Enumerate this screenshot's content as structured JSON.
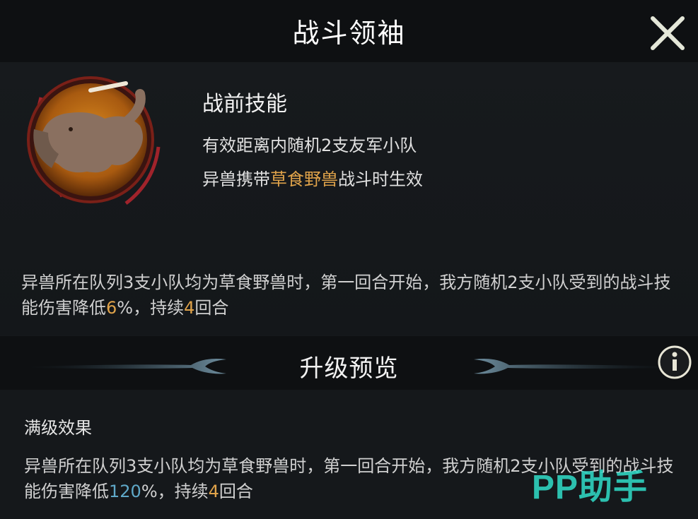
{
  "header": {
    "title": "战斗领袖"
  },
  "skill": {
    "name": "战前技能",
    "line1": "有效距离内随机2支友军小队",
    "line2_pre": "异兽携带",
    "line2_hl": "草食野兽",
    "line2_post": "战斗时生效"
  },
  "description": {
    "pre": "异兽所在队列3支小队均为草食野兽时，第一回合开始，我方随机2支小队受到的战斗技能伤害降低",
    "value": "6",
    "mid": "%，持续",
    "turns": "4",
    "post": "回合"
  },
  "upgrade": {
    "title": "升级预览"
  },
  "max_level": {
    "label": "满级效果",
    "pre": "异兽所在队列3支小队均为草食野兽时，第一回合开始，我方随机2支小队受到的战斗技能伤害降低",
    "value": "120",
    "mid": "%，持续",
    "turns": "4",
    "post": "回合"
  },
  "watermark": {
    "text": "PP助手"
  },
  "colors": {
    "highlight_gold": "#e0a34a",
    "highlight_blue": "#5fa8c8",
    "watermark": "#2fd3c0"
  },
  "icons": {
    "close": "close-icon",
    "info": "info-icon",
    "portrait": "elephant-portrait"
  }
}
